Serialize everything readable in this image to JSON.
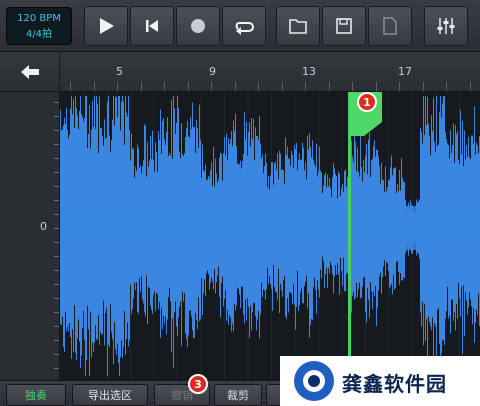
{
  "toolbar": {
    "tempo_bpm": "120 BPM",
    "time_signature": "4/4拍",
    "buttons": [
      {
        "name": "play-icon"
      },
      {
        "name": "skip-to-start-icon"
      },
      {
        "name": "record-icon"
      },
      {
        "name": "loop-icon"
      },
      {
        "name": "folder-icon"
      },
      {
        "name": "save-icon"
      },
      {
        "name": "new-file-icon"
      },
      {
        "name": "mixer-sliders-icon"
      }
    ]
  },
  "ruler": {
    "back_icon": "arrow-left-icon",
    "labels": [
      "5",
      "9",
      "13",
      "17"
    ]
  },
  "track": {
    "zero_label": "0",
    "waveform_color": "#3a86e0",
    "playhead_color": "#47d160",
    "marker_badge": "1"
  },
  "bottom_bar": {
    "solo_label": "独奏",
    "export_label": "导出选区",
    "undo_label": "撤销",
    "undo_badge": "3",
    "trim_label": "裁剪"
  },
  "watermark": {
    "text": "龚鑫软件园"
  }
}
